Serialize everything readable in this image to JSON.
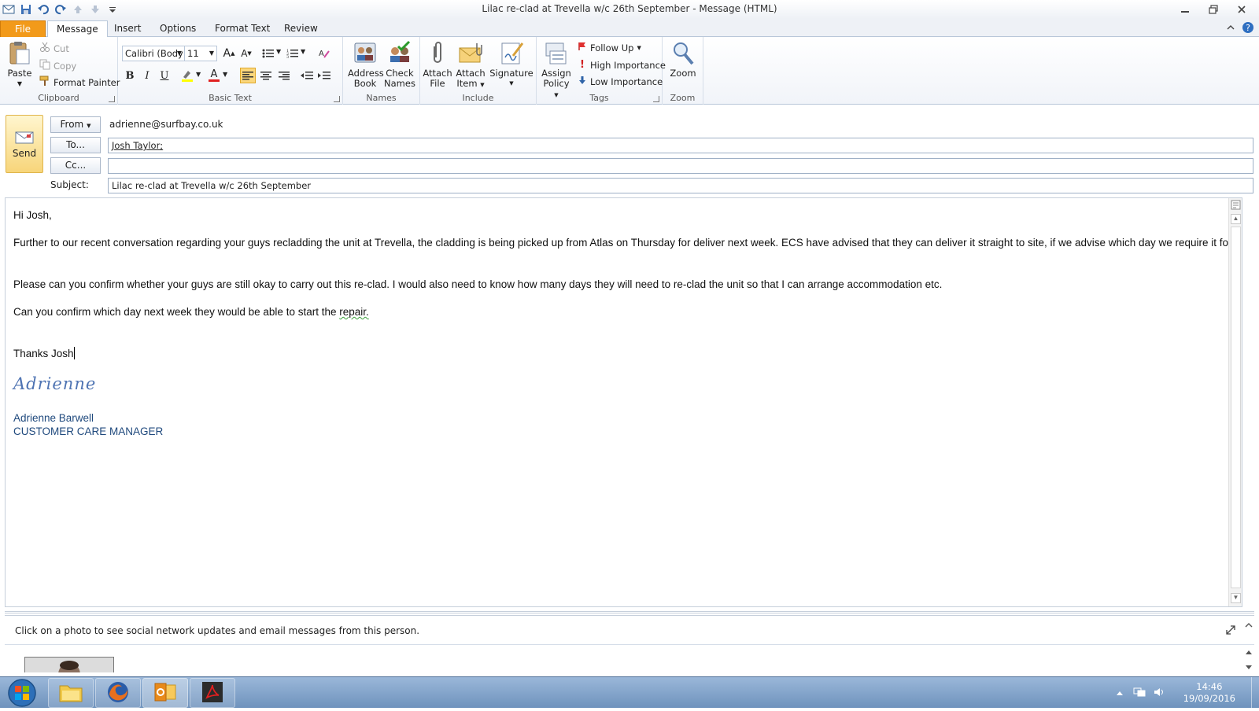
{
  "window": {
    "title": "Lilac re-clad at Trevella w/c 26th  September  - Message (HTML)"
  },
  "ribbon_tabs": [
    "File",
    "Message",
    "Insert",
    "Options",
    "Format Text",
    "Review"
  ],
  "clipboard": {
    "paste": "Paste",
    "cut": "Cut",
    "copy": "Copy",
    "format_painter": "Format Painter",
    "label": "Clipboard"
  },
  "basic_text": {
    "font": "Calibri (Body)",
    "size": "11",
    "label": "Basic Text",
    "bold": "B",
    "italic": "I",
    "underline": "U",
    "grow": "A",
    "shrink": "A",
    "font_color": "A"
  },
  "names": {
    "address_book_1": "Address",
    "address_book_2": "Book",
    "check_names_1": "Check",
    "check_names_2": "Names",
    "label": "Names"
  },
  "include": {
    "attach_file_1": "Attach",
    "attach_file_2": "File",
    "attach_item_1": "Attach",
    "attach_item_2": "Item",
    "signature": "Signature",
    "label": "Include"
  },
  "tags": {
    "assign_policy_1": "Assign",
    "assign_policy_2": "Policy",
    "follow_up": "Follow Up",
    "high_importance": "High Importance",
    "low_importance": "Low Importance",
    "label": "Tags"
  },
  "zoom": {
    "button": "Zoom",
    "label": "Zoom"
  },
  "header": {
    "send": "Send",
    "from_btn": "From",
    "from_value": "adrienne@surfbay.co.uk",
    "to_btn": "To...",
    "to_value": "Josh Taylor;",
    "cc_btn": "Cc...",
    "cc_value": "",
    "subject_label": "Subject:",
    "subject_value": "Lilac re-clad at Trevella w/c 26th  September"
  },
  "body": {
    "greeting": "Hi Josh,",
    "p1": "Further to our recent conversation regarding your guys recladding the unit at Trevella, the cladding is being picked up from Atlas on Thursday for deliver next week.  ECS have advised that they can deliver it straight to site, if we advise which day we require it for.",
    "p2": "Please can you confirm whether your guys are still okay to carry out this re-clad.  I would also need to know how many days they will need to re-clad the unit so that I can arrange accommodation etc.",
    "p3_start": "Can you confirm which day next week they would be able to start the ",
    "p3_word": "repair.",
    "closing": "Thanks Josh",
    "signature_script": "Adrienne",
    "sig_name": "Adrienne Barwell",
    "sig_title": "CUSTOMER CARE MANAGER"
  },
  "people_pane": {
    "message": "Click on a photo to see social network updates and email messages from this person."
  },
  "taskbar": {
    "time": "14:46",
    "date": "19/09/2016"
  },
  "colors": {
    "file_tab": "#f29a1a",
    "signature_blue": "#1f497d",
    "taskbar": "#6f93bd"
  }
}
